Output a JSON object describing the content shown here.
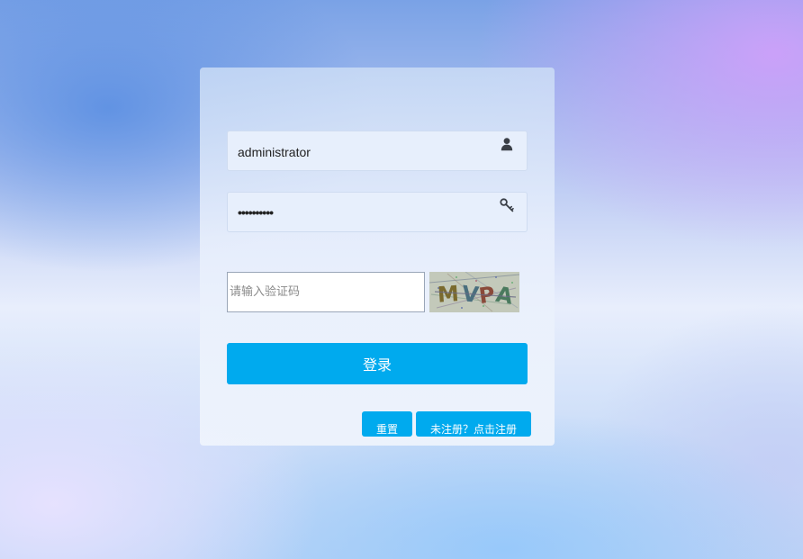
{
  "login_form": {
    "username_value": "administrator",
    "password_value": "••••••••••",
    "captcha_placeholder": "请输入验证码",
    "captcha_value": "",
    "captcha_image_text": "MVPA",
    "login_label": "登录",
    "reset_label": "重置",
    "register_label": "未注册？点击注册"
  },
  "icons": {
    "username": "user-icon",
    "password": "key-icon"
  },
  "colors": {
    "primary_button": "#00aaee",
    "field_background": "#e7effc",
    "icon": "#3a3f47"
  }
}
